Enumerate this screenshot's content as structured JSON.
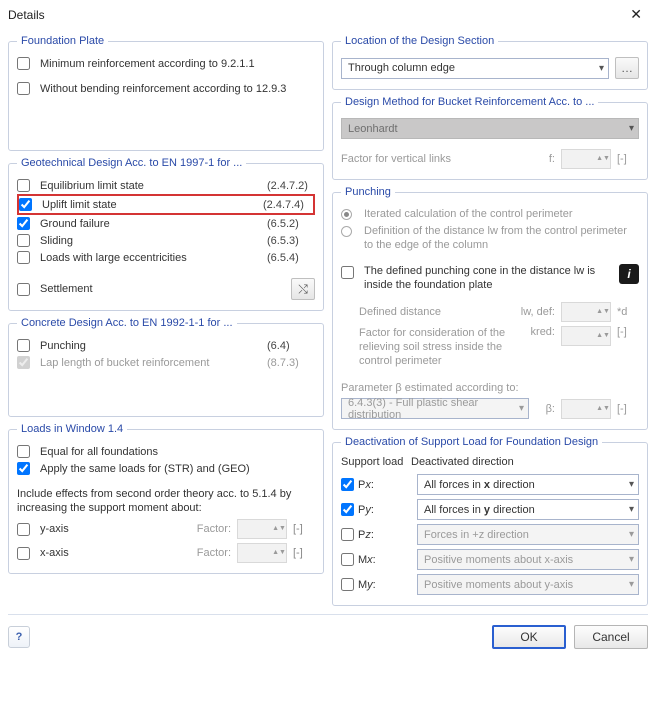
{
  "window": {
    "title": "Details"
  },
  "foundation_plate": {
    "legend": "Foundation Plate",
    "min_reinf": "Minimum reinforcement according to 9.2.1.1",
    "no_bending": "Without bending reinforcement according to 12.9.3"
  },
  "geo": {
    "legend": "Geotechnical Design Acc. to EN 1997-1 for ...",
    "eq": {
      "label": "Equilibrium limit state",
      "ref": "(2.4.7.2)"
    },
    "uplift": {
      "label": "Uplift limit state",
      "ref": "(2.4.7.4)"
    },
    "ground": {
      "label": "Ground failure",
      "ref": "(6.5.2)"
    },
    "sliding": {
      "label": "Sliding",
      "ref": "(6.5.3)"
    },
    "loads_ecc": {
      "label": "Loads with large eccentricities",
      "ref": "(6.5.4)"
    },
    "settlement": {
      "label": "Settlement"
    }
  },
  "concrete": {
    "legend": "Concrete Design Acc. to EN 1992-1-1 for ...",
    "punching": {
      "label": "Punching",
      "ref": "(6.4)"
    },
    "lap": {
      "label": "Lap length of bucket reinforcement",
      "ref": "(8.7.3)"
    }
  },
  "loads14": {
    "legend": "Loads in Window 1.4",
    "equal": "Equal for all foundations",
    "same_str_geo": "Apply the same loads for (STR) and (GEO)",
    "second_order": "Include effects from second order theory acc. to 5.1.4 by increasing the support moment about:",
    "y_axis": "y-axis",
    "x_axis": "x-axis",
    "factor": "Factor:",
    "bracket": "[-]"
  },
  "location": {
    "legend": "Location of the Design Section",
    "select": "Through column edge"
  },
  "bucket": {
    "legend": "Design Method for Bucket Reinforcement Acc. to ...",
    "select": "Leonhardt",
    "factor_label": "Factor for vertical links",
    "f": "f:",
    "bracket": "[-]"
  },
  "punching": {
    "legend": "Punching",
    "iter": "Iterated calculation of the control perimeter",
    "defdist_radio": "Definition of the distance lw from the control perimeter to the edge of the column",
    "cone": "The defined punching cone in the distance lw is inside the foundation plate",
    "defdist_label": "Defined distance",
    "lw_def": "lw, def:",
    "unit_d": "*d",
    "relieve": "Factor for consideration of the relieving soil stress inside the control perimeter",
    "kred": "kred:",
    "bracket": "[-]",
    "beta_label": "Parameter β estimated according to:",
    "beta_select": "6.4.3(3) - Full plastic shear distribution",
    "beta": "β:"
  },
  "deact": {
    "legend": "Deactivation of Support Load for Foundation Design",
    "h1": "Support load",
    "h2": "Deactivated direction",
    "px": "Px:",
    "py": "Py:",
    "pz": "Pz:",
    "mx": "Mx:",
    "my": "My:",
    "sel_px": "All forces in x direction",
    "sel_py": "All forces in y direction",
    "sel_pz": "Forces in +z direction",
    "sel_mx": "Positive moments about x-axis",
    "sel_my": "Positive moments about y-axis"
  },
  "footer": {
    "ok": "OK",
    "cancel": "Cancel"
  }
}
